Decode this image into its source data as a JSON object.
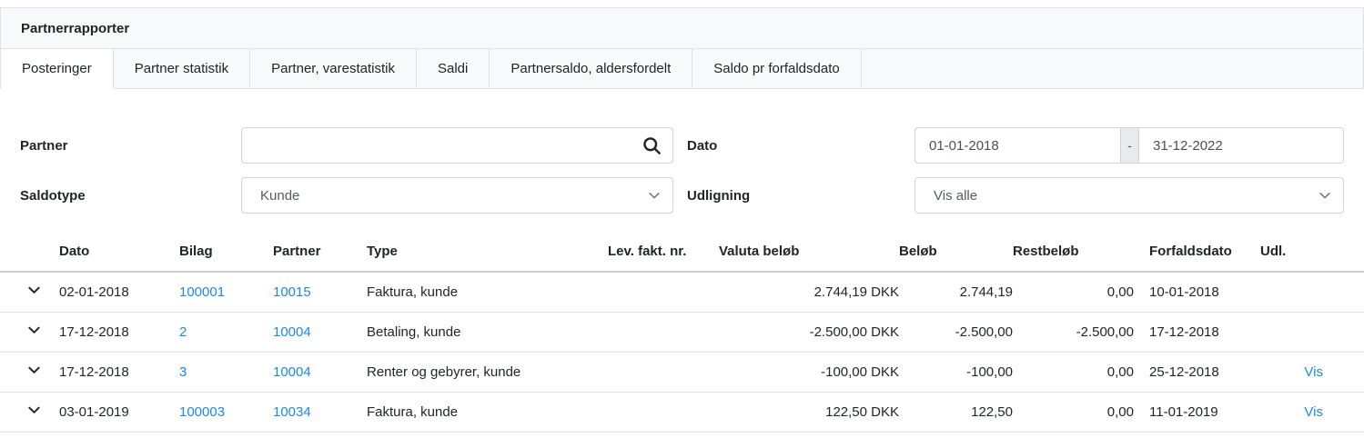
{
  "header": {
    "title": "Partnerrapporter"
  },
  "tabs": [
    {
      "label": "Posteringer",
      "active": true
    },
    {
      "label": "Partner statistik",
      "active": false
    },
    {
      "label": "Partner, varestatistik",
      "active": false
    },
    {
      "label": "Saldi",
      "active": false
    },
    {
      "label": "Partnersaldo, aldersfordelt",
      "active": false
    },
    {
      "label": "Saldo pr forfaldsdato",
      "active": false
    }
  ],
  "filters": {
    "partner": {
      "label": "Partner",
      "value": ""
    },
    "dato": {
      "label": "Dato",
      "from": "01-01-2018",
      "separator": "-",
      "to": "31-12-2022"
    },
    "saldotype": {
      "label": "Saldotype",
      "value": "Kunde"
    },
    "udligning": {
      "label": "Udligning",
      "value": "Vis alle"
    }
  },
  "table": {
    "columns": {
      "dato": "Dato",
      "bilag": "Bilag",
      "partner": "Partner",
      "type": "Type",
      "lev_fakt_nr": "Lev. fakt. nr.",
      "valuta_belob": "Valuta beløb",
      "belob": "Beløb",
      "restbelob": "Restbeløb",
      "forfaldsdato": "Forfaldsdato",
      "udl": "Udl."
    },
    "rows": [
      {
        "dato": "02-01-2018",
        "bilag": "100001",
        "partner": "10015",
        "type": "Faktura, kunde",
        "lev_fakt_nr": "",
        "valuta_belob": "2.744,19 DKK",
        "belob": "2.744,19",
        "restbelob": "0,00",
        "forfaldsdato": "10-01-2018",
        "udl": ""
      },
      {
        "dato": "17-12-2018",
        "bilag": "2",
        "partner": "10004",
        "type": "Betaling, kunde",
        "lev_fakt_nr": "",
        "valuta_belob": "-2.500,00 DKK",
        "belob": "-2.500,00",
        "restbelob": "-2.500,00",
        "forfaldsdato": "17-12-2018",
        "udl": ""
      },
      {
        "dato": "17-12-2018",
        "bilag": "3",
        "partner": "10004",
        "type": "Renter og gebyrer, kunde",
        "lev_fakt_nr": "",
        "valuta_belob": "-100,00 DKK",
        "belob": "-100,00",
        "restbelob": "0,00",
        "forfaldsdato": "25-12-2018",
        "udl": "Vis"
      },
      {
        "dato": "03-01-2019",
        "bilag": "100003",
        "partner": "10034",
        "type": "Faktura, kunde",
        "lev_fakt_nr": "",
        "valuta_belob": "122,50 DKK",
        "belob": "122,50",
        "restbelob": "0,00",
        "forfaldsdato": "11-01-2019",
        "udl": "Vis"
      }
    ]
  },
  "colors": {
    "link_blue": "#1f87e8",
    "band_bg": "#f8f9fa",
    "border": "#dee2e6",
    "input_border": "#ced4da"
  }
}
